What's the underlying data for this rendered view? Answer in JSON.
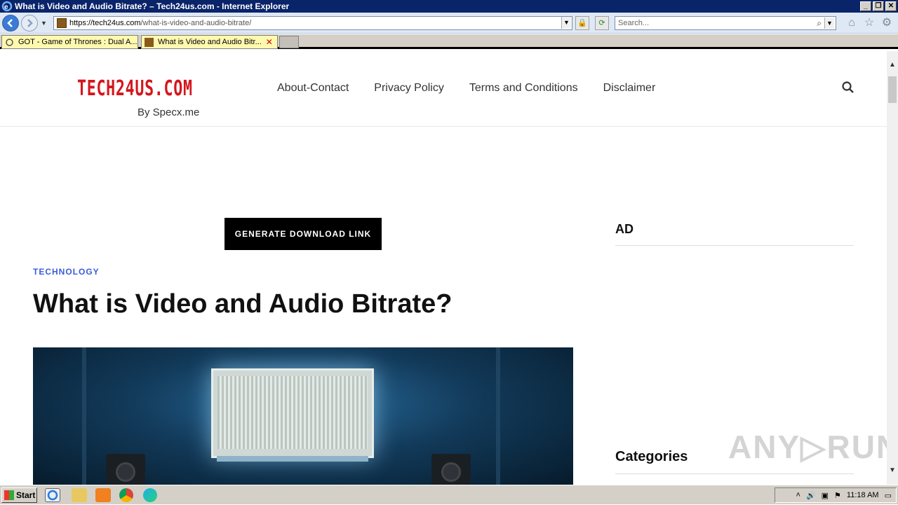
{
  "window": {
    "title": "What is Video and Audio Bitrate? – Tech24us.com - Internet Explorer",
    "controls": {
      "minimize": "_",
      "restore": "❐",
      "close": "✕"
    }
  },
  "navbar": {
    "address_host": "https://tech24us.com",
    "address_path": "/what-is-video-and-audio-bitrate/",
    "search_placeholder": "Search...",
    "icons": [
      "back-icon",
      "forward-icon",
      "lock-icon",
      "refresh-icon",
      "home-icon",
      "star-icon",
      "gear-icon"
    ]
  },
  "tabs": [
    {
      "label": "GOT - Game of Thrones : Dual A...",
      "active": false
    },
    {
      "label": "What is Video and Audio Bitr...",
      "active": true
    }
  ],
  "site": {
    "logo": "TECH24US.COM",
    "logo_sub": "By Specx.me",
    "menu": [
      "About-Contact",
      "Privacy Policy",
      "Terms and Conditions",
      "Disclaimer"
    ],
    "generate_button": "GENERATE DOWNLOAD LINK",
    "category": "TECHNOLOGY",
    "post_title": "What is Video and Audio Bitrate?",
    "sidebar_ad_heading": "AD",
    "sidebar_categories_heading": "Categories",
    "brand_color": "#d4161c",
    "accent_color": "#3d5bd9"
  },
  "watermark": "ANY▷RUN",
  "taskbar": {
    "start_label": "Start",
    "clock": "11:18 AM"
  }
}
